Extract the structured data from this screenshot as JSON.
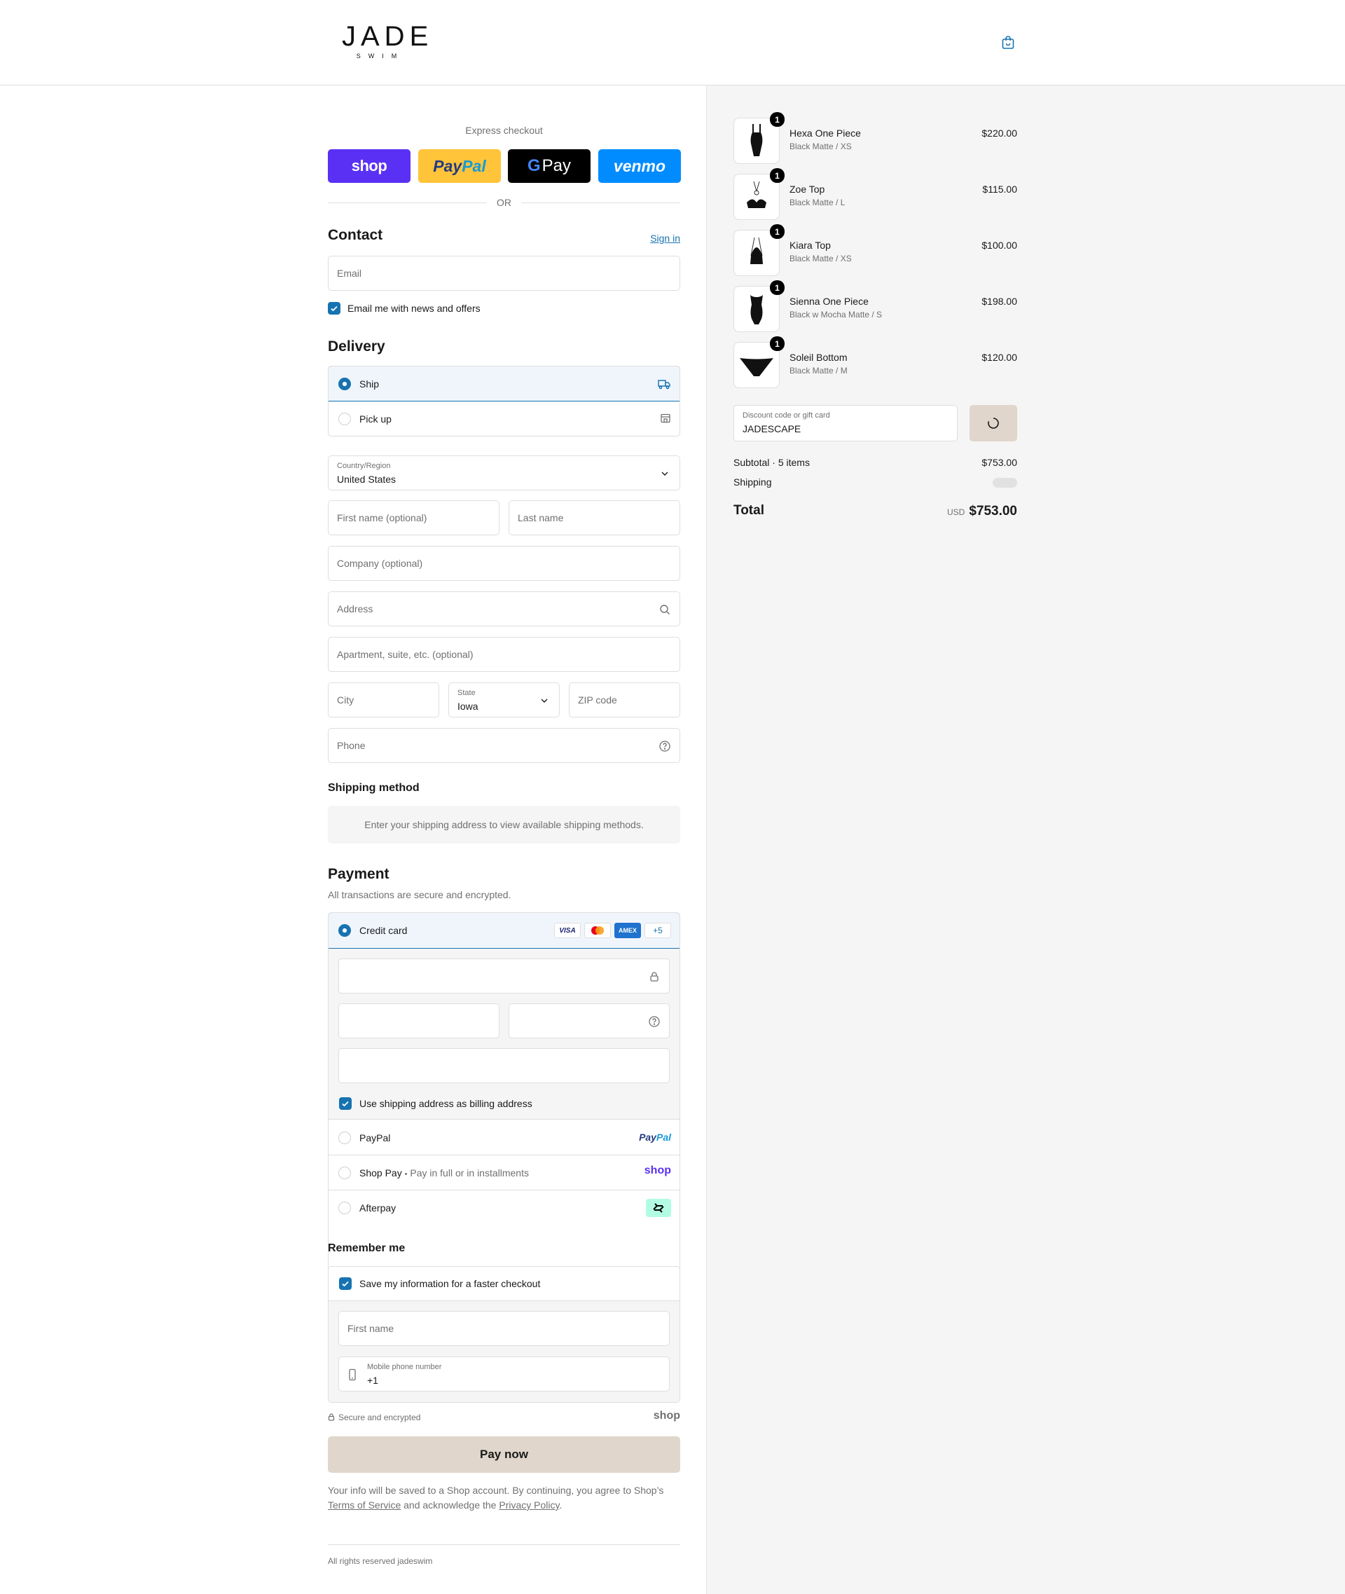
{
  "header": {
    "logo_main": "JADE",
    "logo_sub": "SWIM",
    "cart_icon": "shopping-bag-icon"
  },
  "express": {
    "title": "Express checkout",
    "shop_label": "shop",
    "paypal_label_1": "Pay",
    "paypal_label_2": "Pal",
    "gpay_g": "G",
    "gpay_label": "Pay",
    "venmo_label": "venmo",
    "or_label": "OR"
  },
  "contact": {
    "heading": "Contact",
    "sign_in": "Sign in",
    "email_placeholder": "Email",
    "newsletter_label": "Email me with news and offers",
    "newsletter_checked": true
  },
  "delivery": {
    "heading": "Delivery",
    "options": [
      {
        "label": "Ship",
        "selected": true,
        "icon": "truck-icon"
      },
      {
        "label": "Pick up",
        "selected": false,
        "icon": "store-icon"
      }
    ],
    "country_label": "Country/Region",
    "country_value": "United States",
    "first_name_placeholder": "First name (optional)",
    "last_name_placeholder": "Last name",
    "company_placeholder": "Company (optional)",
    "address_placeholder": "Address",
    "apartment_placeholder": "Apartment, suite, etc. (optional)",
    "city_placeholder": "City",
    "state_label": "State",
    "state_value": "Iowa",
    "zip_placeholder": "ZIP code",
    "phone_placeholder": "Phone"
  },
  "shipping_method": {
    "heading": "Shipping method",
    "info": "Enter your shipping address to view available shipping methods."
  },
  "payment": {
    "heading": "Payment",
    "subtitle": "All transactions are secure and encrypted.",
    "credit_card_label": "Credit card",
    "card_logos": {
      "visa": "VISA",
      "amex": "AMEX",
      "more": "+5"
    },
    "billing_label": "Use shipping address as billing address",
    "billing_checked": true,
    "paypal_label": "PayPal",
    "paypal_logo_1": "Pay",
    "paypal_logo_2": "Pal",
    "shoppay_label": "Shop Pay",
    "shoppay_sep": "•",
    "shoppay_sub": "Pay in full or in installments",
    "shoppay_logo": "shop",
    "afterpay_label": "Afterpay"
  },
  "remember": {
    "heading": "Remember me",
    "save_label": "Save my information for a faster checkout",
    "save_checked": true,
    "first_name_placeholder": "First name",
    "phone_label": "Mobile phone number",
    "phone_value": "+1",
    "secure_label": "Secure and encrypted",
    "shop_logo": "shop"
  },
  "pay_now": "Pay now",
  "legal": {
    "text_1": "Your info will be saved to a Shop account. By continuing, you agree to Shop’s",
    "tos": "Terms of Service",
    "text_2": " and acknowledge the ",
    "privacy": "Privacy Policy",
    "text_3": "."
  },
  "footer": "All rights reserved jadeswim",
  "summary": {
    "items": [
      {
        "name": "Hexa One Piece",
        "variant": "Black Matte / XS",
        "price": "$220.00",
        "qty": "1"
      },
      {
        "name": "Zoe Top",
        "variant": "Black Matte / L",
        "price": "$115.00",
        "qty": "1"
      },
      {
        "name": "Kiara Top",
        "variant": "Black Matte / XS",
        "price": "$100.00",
        "qty": "1"
      },
      {
        "name": "Sienna One Piece",
        "variant": "Black w Mocha Matte / S",
        "price": "$198.00",
        "qty": "1"
      },
      {
        "name": "Soleil Bottom",
        "variant": "Black Matte / M",
        "price": "$120.00",
        "qty": "1"
      }
    ],
    "discount_label": "Discount code or gift card",
    "discount_value": "JADESCAPE",
    "subtotal_label": "Subtotal · 5 items",
    "subtotal_value": "$753.00",
    "shipping_label": "Shipping",
    "total_label": "Total",
    "currency": "USD",
    "total_value": "$753.00"
  },
  "colors": {
    "accent": "#1773b0",
    "button": "#e0d6cb",
    "shop_purple": "#5a31f4",
    "paypal_yellow": "#ffc439",
    "venmo_blue": "#008cff",
    "afterpay_mint": "#b2fce4"
  }
}
